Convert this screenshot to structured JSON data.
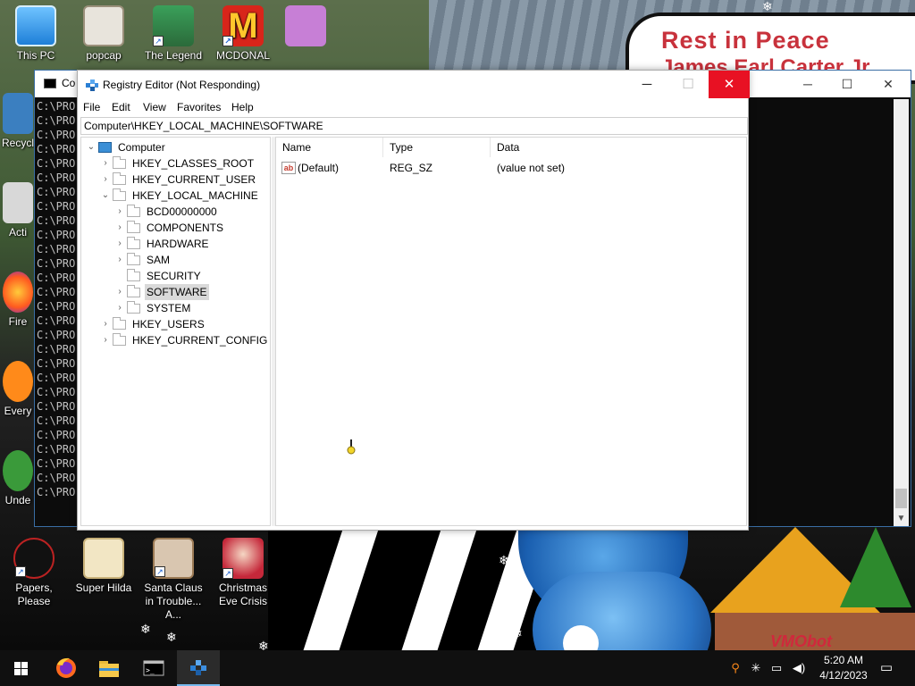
{
  "desktop": {
    "icons": [
      {
        "label": "This PC",
        "icon": "this-pc-icon"
      },
      {
        "label": "popcap",
        "icon": "popcap-icon"
      },
      {
        "label": "The Legend",
        "icon": "legend-game-icon"
      },
      {
        "label": "MCDONAL",
        "icon": "mcdonalds-icon"
      },
      {
        "label": "Recycl",
        "icon": "recycle-bin-icon"
      },
      {
        "label": "Acti",
        "icon": "activate-icon"
      },
      {
        "label": "Fire",
        "icon": "firefox-icon"
      },
      {
        "label": "Every",
        "icon": "everything-icon"
      },
      {
        "label": "Unde",
        "icon": "undertale-icon"
      },
      {
        "label": "Papers, Please",
        "icon": "papers-please-icon"
      },
      {
        "label": "Super Hilda",
        "icon": "super-hilda-icon"
      },
      {
        "label": "Santa Claus in Trouble... A...",
        "icon": "santa-claus-icon"
      },
      {
        "label": "Christmas Eve Crisis",
        "icon": "christmas-eve-icon"
      }
    ],
    "wallpaper_sign": {
      "line1": "Rest in Peace",
      "line2": "James Earl Carter Jr"
    },
    "wallpaper_watermark": "VMObot"
  },
  "cmd_window": {
    "title": "Co",
    "line_text": "C:\\PRO",
    "line_count": 28,
    "controls": {
      "minimize": "─",
      "maximize": "☐",
      "close": "✕"
    }
  },
  "regedit": {
    "title": "Registry Editor (Not Responding)",
    "controls": {
      "minimize": "─",
      "maximize": "☐",
      "close": "✕"
    },
    "menu": [
      "File",
      "Edit",
      "View",
      "Favorites",
      "Help"
    ],
    "address": "Computer\\HKEY_LOCAL_MACHINE\\SOFTWARE",
    "tree": {
      "root": "Computer",
      "hives": [
        "HKEY_CLASSES_ROOT",
        "HKEY_CURRENT_USER",
        "HKEY_LOCAL_MACHINE"
      ],
      "hklm_children": [
        "BCD00000000",
        "COMPONENTS",
        "HARDWARE",
        "SAM",
        "SECURITY",
        "SOFTWARE",
        "SYSTEM"
      ],
      "hives_after": [
        "HKEY_USERS",
        "HKEY_CURRENT_CONFIG"
      ],
      "selected": "SOFTWARE"
    },
    "list": {
      "columns": [
        "Name",
        "Type",
        "Data"
      ],
      "rows": [
        {
          "name": "(Default)",
          "type": "REG_SZ",
          "data": "(value not set)"
        }
      ]
    }
  },
  "taskbar": {
    "items": [
      "start-icon",
      "firefox-icon",
      "file-explorer-icon",
      "command-prompt-icon",
      "registry-editor-icon"
    ],
    "clock_time": "5:20 AM",
    "clock_date": "4/12/2023"
  },
  "colors": {
    "close_red": "#e81123",
    "selection_gray": "#d9d9d9",
    "taskbar": "#101010",
    "sign_red": "#c8323c"
  }
}
